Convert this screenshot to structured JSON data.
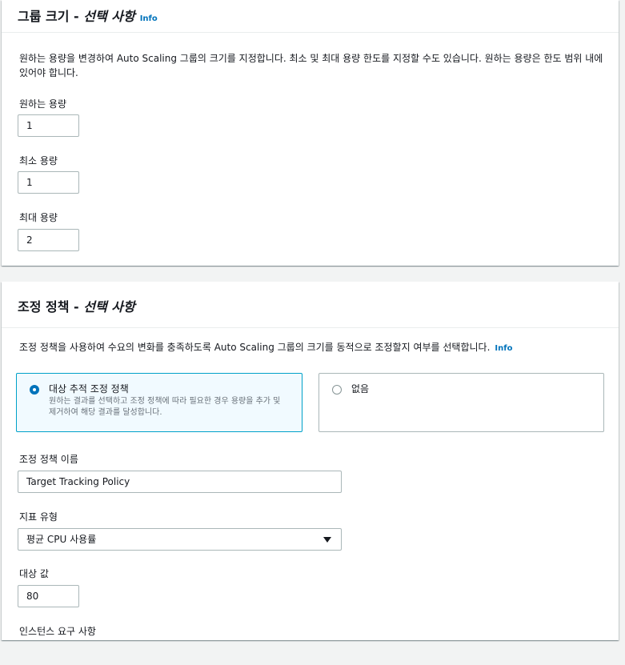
{
  "group_size": {
    "title": "그룹 크기 - ",
    "title_optional": "선택 사항",
    "info_label": "Info",
    "description": "원하는 용량을 변경하여 Auto Scaling 그룹의 크기를 지정합니다. 최소 및 최대 용량 한도를 지정할 수도 있습니다. 원하는 용량은 한도 범위 내에 있어야 합니다.",
    "desired_label": "원하는 용량",
    "desired_value": "1",
    "min_label": "최소 용량",
    "min_value": "1",
    "max_label": "최대 용량",
    "max_value": "2"
  },
  "scaling_policy": {
    "title": "조정 정책 - ",
    "title_optional": "선택 사항",
    "description": "조정 정책을 사용하여 수요의 변화를 충족하도록 Auto Scaling 그룹의 크기를 동적으로 조정할지 여부를 선택합니다.",
    "info_label": "Info",
    "option_target": {
      "label": "대상 추적 조정 정책",
      "description": "원하는 결과를 선택하고 조정 정책에 따라 필요한 경우 용량을 추가 및 제거하여 해당 결과를 달성합니다.",
      "selected": true
    },
    "option_none": {
      "label": "없음",
      "selected": false
    },
    "policy_name_label": "조정 정책 이름",
    "policy_name_value": "Target Tracking Policy",
    "metric_type_label": "지표 유형",
    "metric_type_value": "평균 CPU 사용률",
    "target_value_label": "대상 값",
    "target_value": "80",
    "instance_requirements_label": "인스턴스 요구 사항"
  },
  "colors": {
    "accent": "#0073bb",
    "selected_tile_bg": "#f1faff",
    "selected_tile_border": "#00a1c9",
    "page_bg": "#f2f3f3"
  }
}
